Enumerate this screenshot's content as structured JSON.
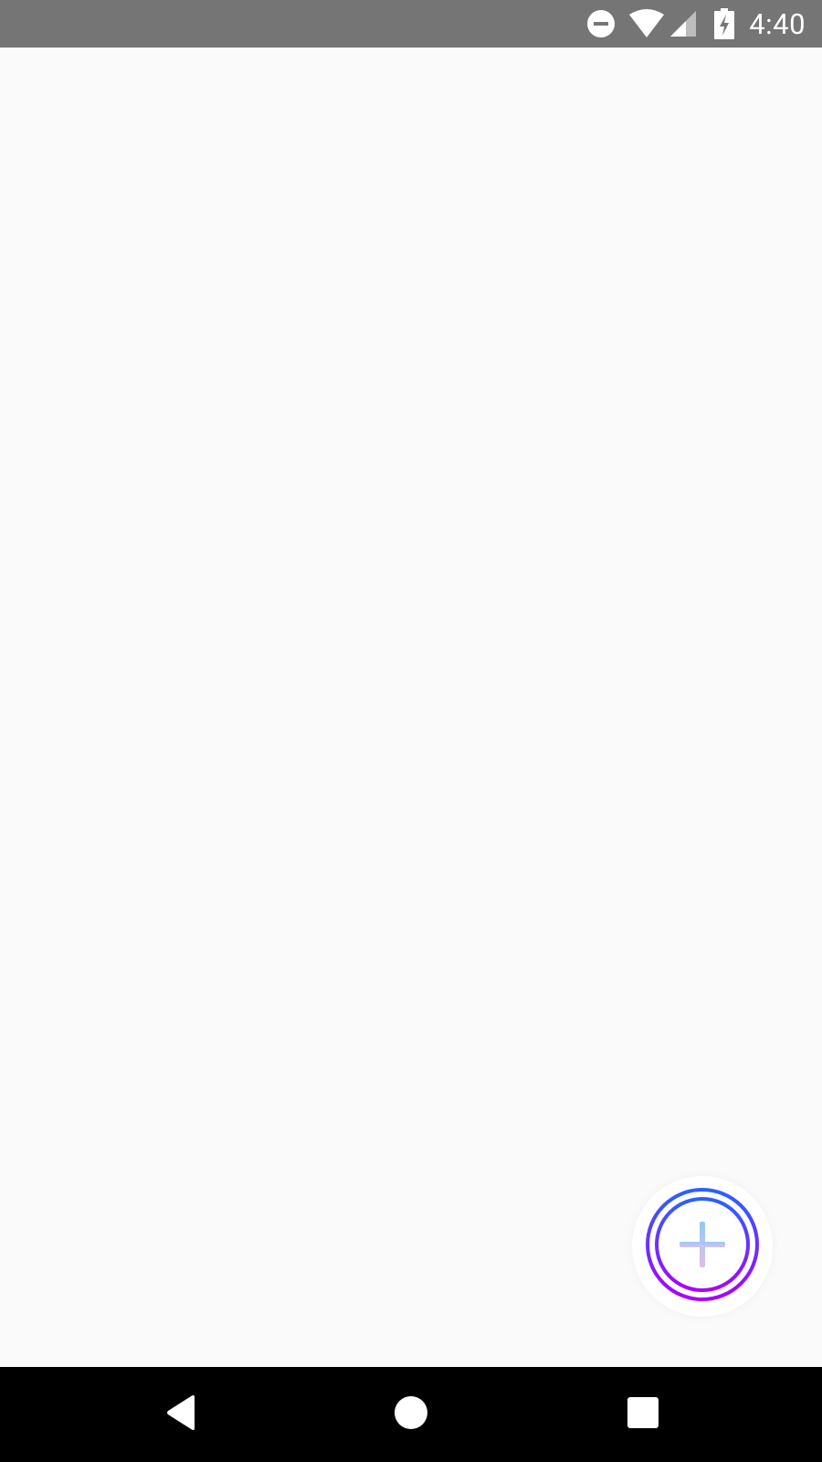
{
  "status_bar": {
    "time": "4:40",
    "icons": [
      "do-not-disturb-icon",
      "wifi-icon",
      "cellular-signal-icon",
      "battery-charging-icon"
    ],
    "background": "#757575"
  },
  "fab": {
    "icon": "add-icon",
    "gradient_start": "#2962ff",
    "gradient_end": "#aa00ff",
    "plus_start": "#90caf9",
    "plus_end": "#e1bee7"
  },
  "nav_bar": {
    "buttons": [
      "back-icon",
      "home-icon",
      "recents-icon"
    ],
    "background": "#000000"
  }
}
